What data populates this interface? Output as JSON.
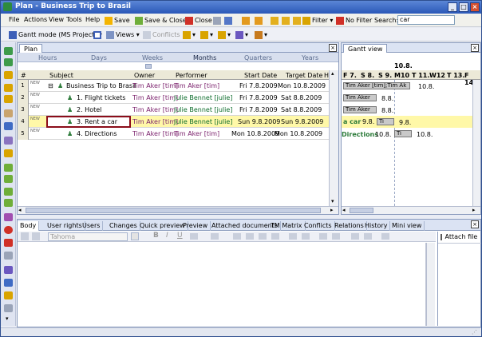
{
  "window": {
    "title": "Plan - Business Trip to Brasil"
  },
  "menu": [
    "File",
    "Actions",
    "View",
    "Tools",
    "Help"
  ],
  "toolbar1": {
    "save": "Save",
    "save_close": "Save & Close",
    "close": "Close",
    "filter": "Filter",
    "no_filter": "No Filter",
    "search_label": "Search:",
    "search_value": "car"
  },
  "toolbar2": {
    "gantt_mode": "Gantt mode (MS Project)",
    "views": "Views",
    "conflicts": "Conflicts"
  },
  "plan": {
    "tab": "Plan",
    "scale": [
      "Hours",
      "Days",
      "Weeks",
      "Months",
      "Quarters",
      "Years"
    ],
    "columns": [
      "#",
      "Subject",
      "Owner",
      "Performer",
      "Start Date",
      "Target Date",
      "Hou"
    ],
    "rows": [
      {
        "num": "1",
        "subject": "Business Trip to Brasil",
        "owner": "Tim Aker [tim]",
        "performer": "Tim Aker [tim]",
        "start": "Fri 7.8.2009",
        "target": "Mon 10.8.2009"
      },
      {
        "num": "2",
        "subject": "1. Flight tickets",
        "owner": "Tim Aker [tim]",
        "performer": "Julie Bennet [julie]",
        "start": "Fri 7.8.2009",
        "target": "Sat 8.8.2009"
      },
      {
        "num": "3",
        "subject": "2. Hotel",
        "owner": "Tim Aker [tim]",
        "performer": "Julie Bennet [julie]",
        "start": "Fri 7.8.2009",
        "target": "Sat 8.8.2009"
      },
      {
        "num": "4",
        "subject": "3. Rent a car",
        "owner": "Tim Aker [tim]",
        "performer": "Julie Bennet [julie]",
        "start": "Sun 9.8.2009",
        "target": "Sun 9.8.2009"
      },
      {
        "num": "5",
        "subject": "4. Directions",
        "owner": "Tim Aker [tim]",
        "performer": "Tim Aker [tim]",
        "start": "Mon 10.8.2009",
        "target": "Mon 10.8.2009"
      }
    ],
    "new_badge": "NEW"
  },
  "gantt": {
    "tab": "Gantt view",
    "top_date": "10.8.",
    "days": [
      "F 7.",
      "S 8.",
      "S 9.",
      "M10",
      "T 11.",
      "W12",
      "T 13.",
      "F 14."
    ],
    "r1_bar": "Tim Aker [tim];Tim Ak",
    "r1_after": "10.8.",
    "r2_bar": "Tim Aker",
    "r2_after": "8.8.",
    "r3_bar": "Tim Aker",
    "r3_after": "8.8.",
    "r4_lead": "a car",
    "r4_date": "9.8.",
    "r4_bar": "Ti",
    "r4_after": "9.8.",
    "r5_lead": "Directions",
    "r5_date": "10.8.",
    "r5_bar": "Ti",
    "r5_after": "10.8."
  },
  "bottom": {
    "tabs": [
      "Body",
      "User rights",
      "Users",
      "Changes",
      "Quick preview",
      "Preview",
      "Attached documents",
      "TM Matrix",
      "Conflicts",
      "Relations",
      "History",
      "Mini view"
    ],
    "font": "Tahoma",
    "attach": "Attach file"
  }
}
